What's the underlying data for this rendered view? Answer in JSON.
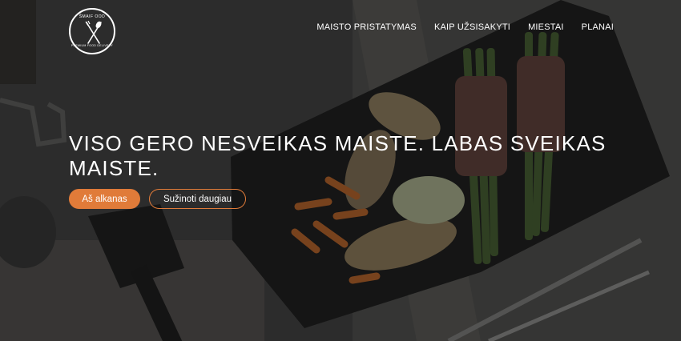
{
  "logo": {
    "top_text": "ŠMAIF OOD",
    "bottom_text": "PREMIUM FOOD DELIVERY"
  },
  "nav": {
    "items": [
      {
        "label": "MAISTO PRISTATYMAS"
      },
      {
        "label": "KAIP UŽSISAKYTI"
      },
      {
        "label": "MIESTAI"
      },
      {
        "label": "PLANAI"
      }
    ]
  },
  "hero": {
    "headline": "VISO GERO NESVEIKAS MAISTE. LABAS SVEIKAS MAISTE.",
    "primary_button": "Aš alkanas",
    "secondary_button": "Sužinoti daugiau"
  },
  "colors": {
    "accent": "#e07b39",
    "text": "#ffffff"
  },
  "icons": [
    "fork-icon",
    "spoon-icon"
  ]
}
